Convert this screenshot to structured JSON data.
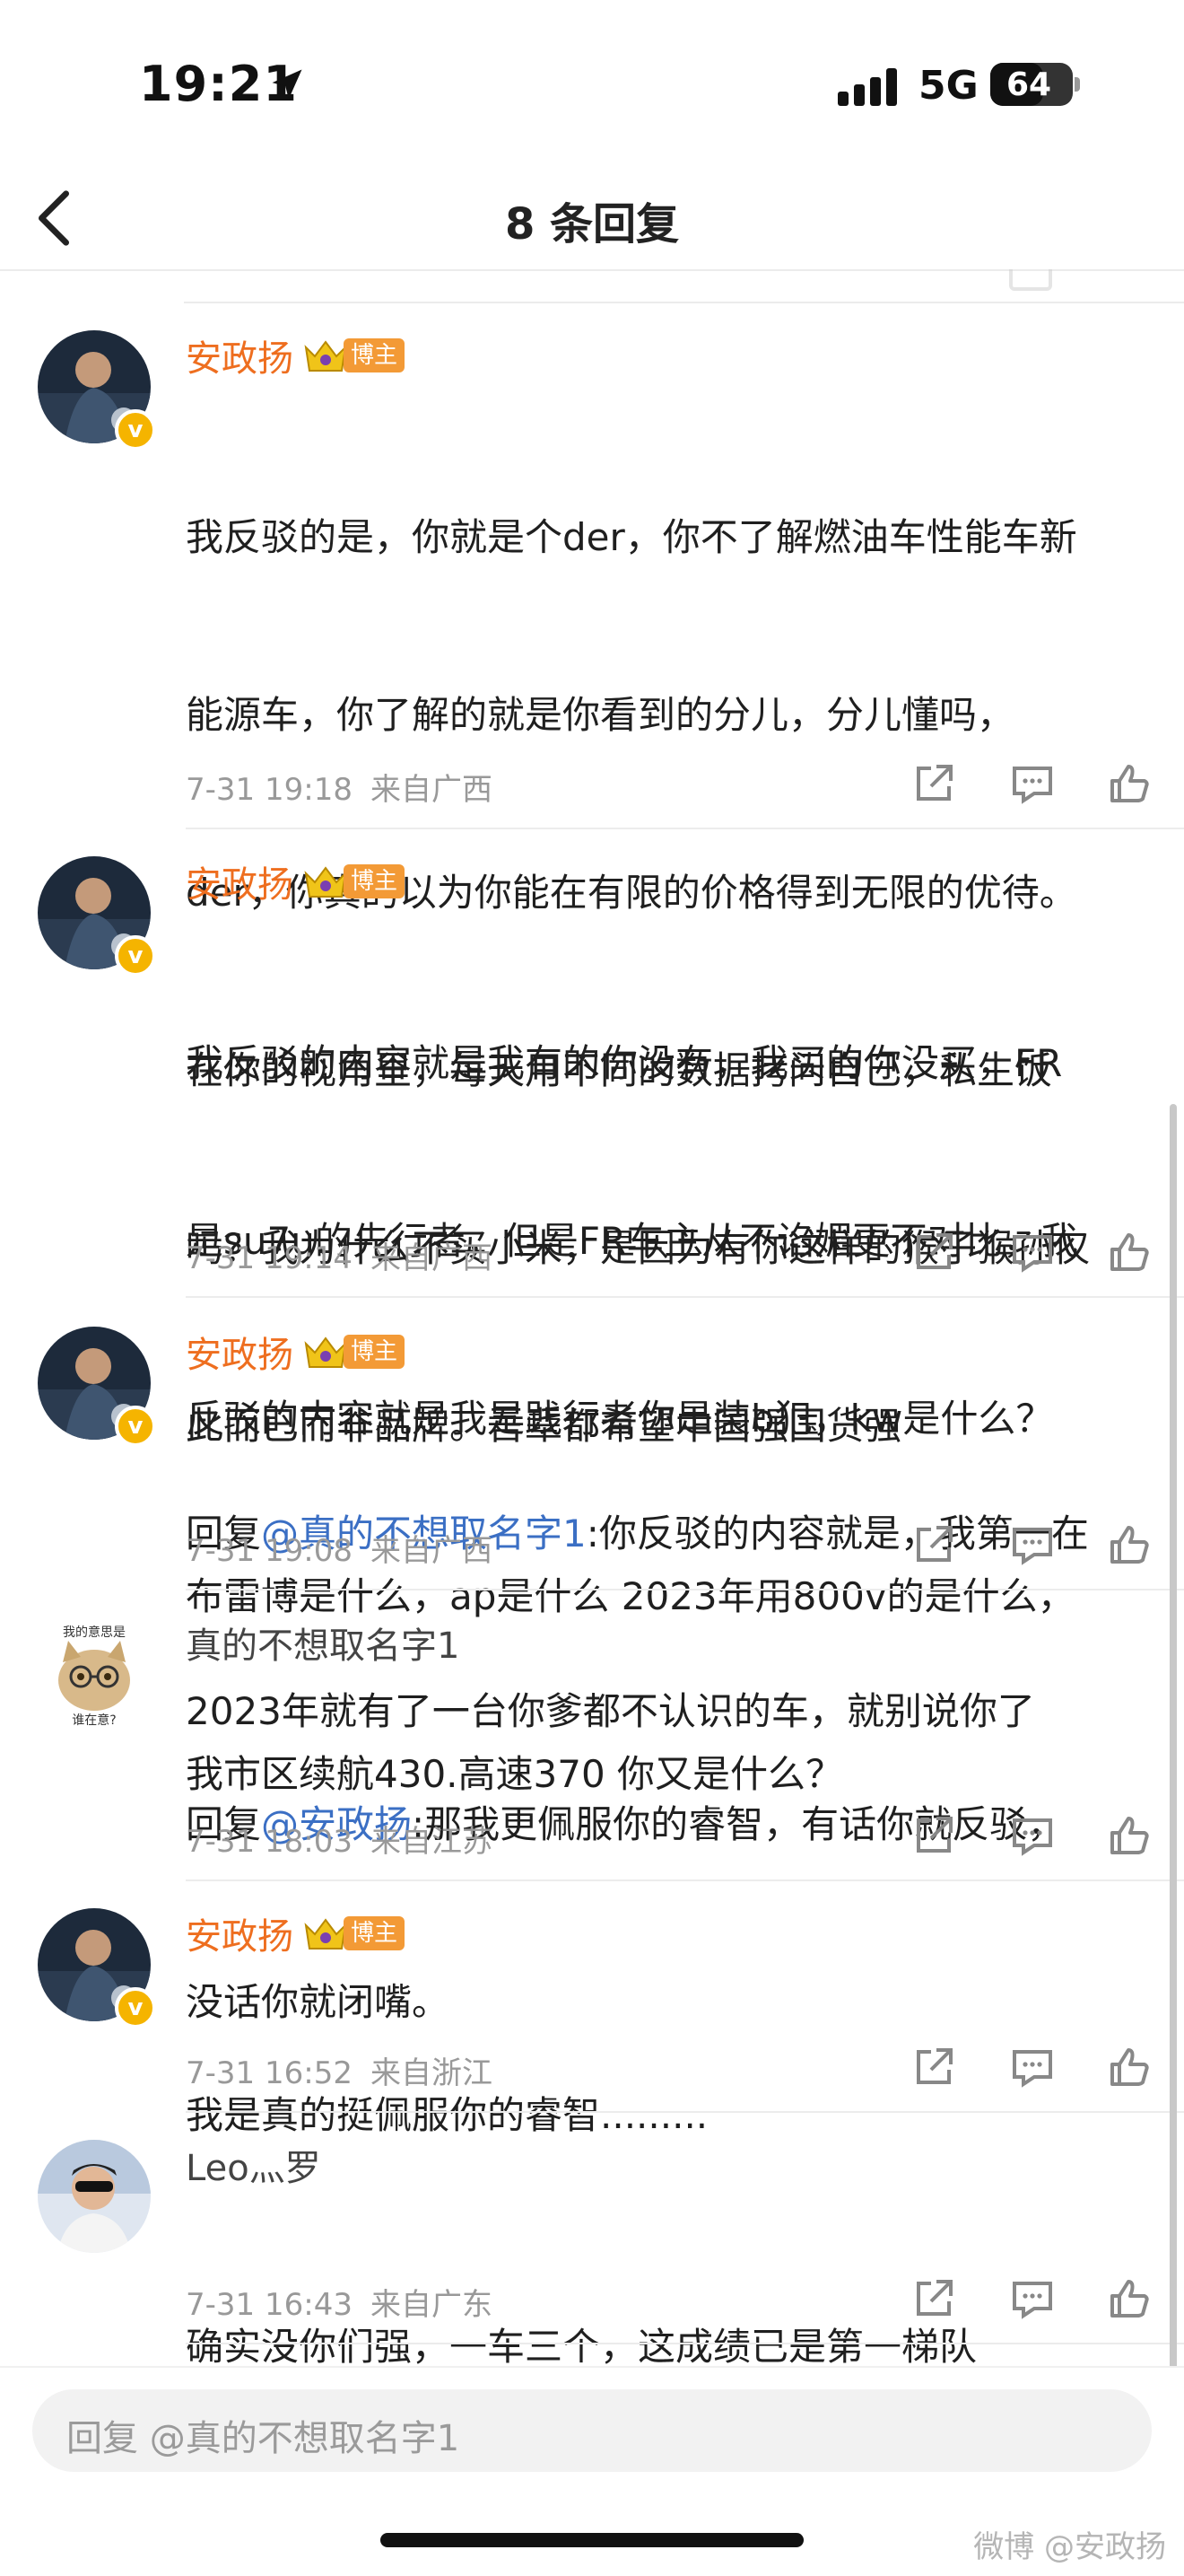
{
  "status_bar": {
    "time": "19:21",
    "network": "5G",
    "battery": "64",
    "battery_level": 0.64
  },
  "header": {
    "title": "8 条回复"
  },
  "badge_label": "博主",
  "comments": [
    {
      "author": "安政扬",
      "is_blogger": true,
      "text": "我反驳的是，你就是个der，你不了解燃油车性能车新能源车，你了解的就是你看到的分儿，分儿懂吗，der，你真的以为你能在有限的价格得到无限的优待。在你的视角里，每天用不同的数据拷问自己，私生饭吗？我为什么不买小米，是因为有你这样的猴子猴孙仅此而已而非品牌。吾辈都希望中国强国货强",
      "lines": [
        "我反驳的是，你就是个der，你不了解燃油车性能车新",
        "能源车，你了解的就是你看到的分儿，分儿懂吗，",
        "der，你真的以为你能在有限的价格得到无限的优待。",
        "在你的视角里，每天用不同的数据拷问自己，私生饭",
        "吗？我为什么不买小米，是因为有你这样的猴子猴孙仅",
        "此而已而非品牌。吾辈都希望中国强国货强"
      ],
      "time": "7-31 19:18",
      "location": "来自广西"
    },
    {
      "author": "安政扬",
      "is_blogger": true,
      "lines": [
        "我反驳的内容就是我有的你没有，我买的你没买，FR",
        "是su7u的先行者，但是FR车主从不谄媚更不对比，我",
        "反驳的内容就是我是践行者你是装b犯，kw是什么？",
        "布雷博是什么，ap是什么 2023年用800v的是什么，",
        "我市区续航430.高速370 你又是什么？"
      ],
      "time": "7-31 19:14",
      "location": "来自广西"
    },
    {
      "author": "安政扬",
      "is_blogger": true,
      "reply_prefix": "回复",
      "mention": "@真的不想取名字1",
      "reply_text_line1": ":你反驳的内容就是，我第一在",
      "reply_text_line2": "2023年就有了一台你爹都不认识的车，就别说你了",
      "time": "7-31 19:08",
      "location": "来自广西"
    },
    {
      "author": "真的不想取名字1",
      "is_blogger": false,
      "avatar_caption_top": "我的意思是",
      "avatar_caption_bottom": "谁在意?",
      "reply_prefix": "回复",
      "mention": "@安政扬",
      "reply_text_line1": ":那我更佩服你的睿智，有话你就反驳，",
      "reply_text_line2": "没话你就闭嘴。",
      "time": "7-31 18:03",
      "location": "来自江苏"
    },
    {
      "author": "安政扬",
      "is_blogger": true,
      "lines": [
        "我是真的挺佩服你的睿智........."
      ],
      "time": "7-31 16:52",
      "location": "来自浙江"
    },
    {
      "author": "Leo灬罗",
      "is_blogger": false,
      "lines": [
        "确实没你们强，一车三个，这成绩已是第一梯队"
      ],
      "time": "7-31 16:43",
      "location": "来自广东"
    }
  ],
  "input": {
    "placeholder": "回复 @真的不想取名字1"
  },
  "watermark": "微博 @安政扬",
  "colors": {
    "accent_name": "#ee6e1f",
    "mention": "#3b6fc4",
    "badge": "#f39a36",
    "verified": "#f5b400"
  }
}
